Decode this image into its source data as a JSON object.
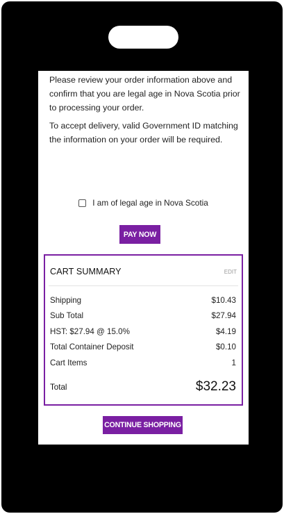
{
  "notice": {
    "line1": "Please review your order information above and confirm that you are legal age in Nova Scotia prior to processing your order.",
    "line2": "To accept delivery, valid Government ID matching the information on your order will be required."
  },
  "age_check": {
    "label": "I am of legal age in Nova Scotia",
    "checked": false
  },
  "pay_button": {
    "label": "PAY NOW"
  },
  "cart": {
    "title": "CART SUMMARY",
    "edit_label": "EDIT",
    "rows": [
      {
        "label": "Shipping",
        "value": "$10.43"
      },
      {
        "label": "Sub Total",
        "value": "$27.94"
      },
      {
        "label": "HST: $27.94 @ 15.0%",
        "value": "$4.19"
      },
      {
        "label": "Total Container Deposit",
        "value": "$0.10"
      },
      {
        "label": "Cart Items",
        "value": "1"
      }
    ],
    "total_label": "Total",
    "total_value": "$32.23"
  },
  "continue_button": {
    "label": "CONTINUE SHOPPING"
  },
  "colors": {
    "accent": "#7a1fa2",
    "frame": "#000000"
  }
}
